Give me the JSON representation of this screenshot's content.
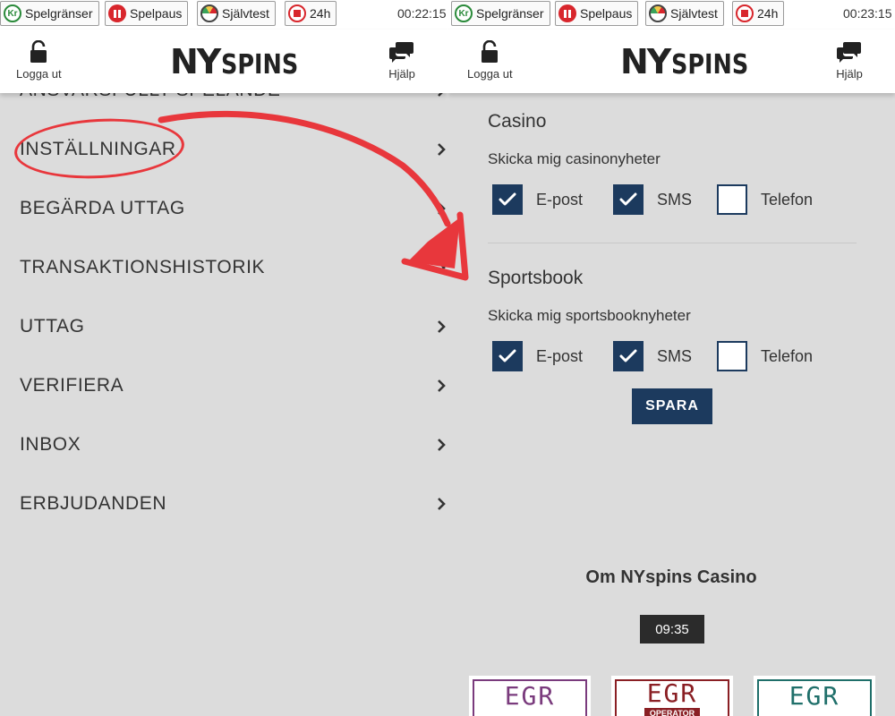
{
  "left_panel": {
    "toolbar": {
      "limits_label": "Spelgränser",
      "limits_badge": "Kr",
      "pause_label": "Spelpaus",
      "selftest_label": "Självtest",
      "timeout_label": "24h",
      "clock": "00:22:15"
    },
    "header": {
      "logout_label": "Logga ut",
      "logo_ny": "NY",
      "logo_spins": "SPINS",
      "help_label": "Hjälp"
    },
    "menu": [
      {
        "label": "ANSVARSFULLT SPELANDE"
      },
      {
        "label": "INSTÄLLNINGAR"
      },
      {
        "label": "BEGÄRDA UTTAG"
      },
      {
        "label": "TRANSAKTIONSHISTORIK"
      },
      {
        "label": "UTTAG"
      },
      {
        "label": "VERIFIERA"
      },
      {
        "label": "INBOX"
      },
      {
        "label": "ERBJUDANDEN"
      }
    ]
  },
  "right_panel": {
    "toolbar": {
      "limits_label": "Spelgränser",
      "limits_badge": "Kr",
      "pause_label": "Spelpaus",
      "selftest_label": "Självtest",
      "timeout_label": "24h",
      "clock": "00:23:15"
    },
    "header": {
      "logout_label": "Logga ut",
      "logo_ny": "NY",
      "logo_spins": "SPINS",
      "help_label": "Hjälp"
    },
    "casino": {
      "title": "Casino",
      "subtitle": "Skicka mig casinonyheter",
      "options": [
        {
          "label": "E-post",
          "checked": true
        },
        {
          "label": "SMS",
          "checked": true
        },
        {
          "label": "Telefon",
          "checked": false
        }
      ]
    },
    "sportsbook": {
      "title": "Sportsbook",
      "subtitle": "Skicka mig sportsbooknyheter",
      "options": [
        {
          "label": "E-post",
          "checked": true
        },
        {
          "label": "SMS",
          "checked": true
        },
        {
          "label": "Telefon",
          "checked": false
        }
      ]
    },
    "save_label": "SPARA",
    "about_title": "Om NYspins Casino",
    "time_badge": "09:35",
    "award_badges": [
      {
        "logo": "EGR",
        "color": "#7a3b7d"
      },
      {
        "logo": "EGR",
        "color": "#8a1f24",
        "caption": "OPERATOR"
      },
      {
        "logo": "EGR",
        "color": "#1f6f6a"
      }
    ]
  },
  "colors": {
    "background": "#dcdcdc",
    "navy": "#1c3a5e",
    "highlight_red": "#e8373c",
    "pause_red": "#d8262c",
    "limits_green": "#2a8a3a"
  }
}
